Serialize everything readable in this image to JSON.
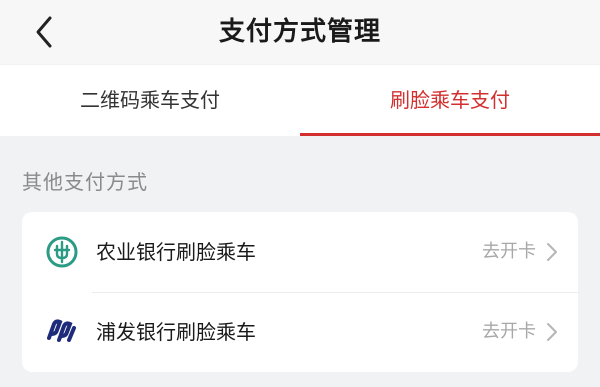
{
  "header": {
    "title": "支付方式管理",
    "back_icon": "chevron-left-icon"
  },
  "tabs": [
    {
      "label": "二维码乘车支付",
      "active": false
    },
    {
      "label": "刷脸乘车支付",
      "active": true
    }
  ],
  "section": {
    "title": "其他支付方式"
  },
  "payment_methods": [
    {
      "label": "农业银行刷脸乘车",
      "action": "去开卡",
      "icon": "abc-bank-logo-icon",
      "icon_color": "#2b9b84"
    },
    {
      "label": "浦发银行刷脸乘车",
      "action": "去开卡",
      "icon": "spdb-bank-logo-icon",
      "icon_color": "#1d2b7a"
    }
  ],
  "colors": {
    "accent": "#d32f2f",
    "page_background": "#f1f2f4"
  }
}
